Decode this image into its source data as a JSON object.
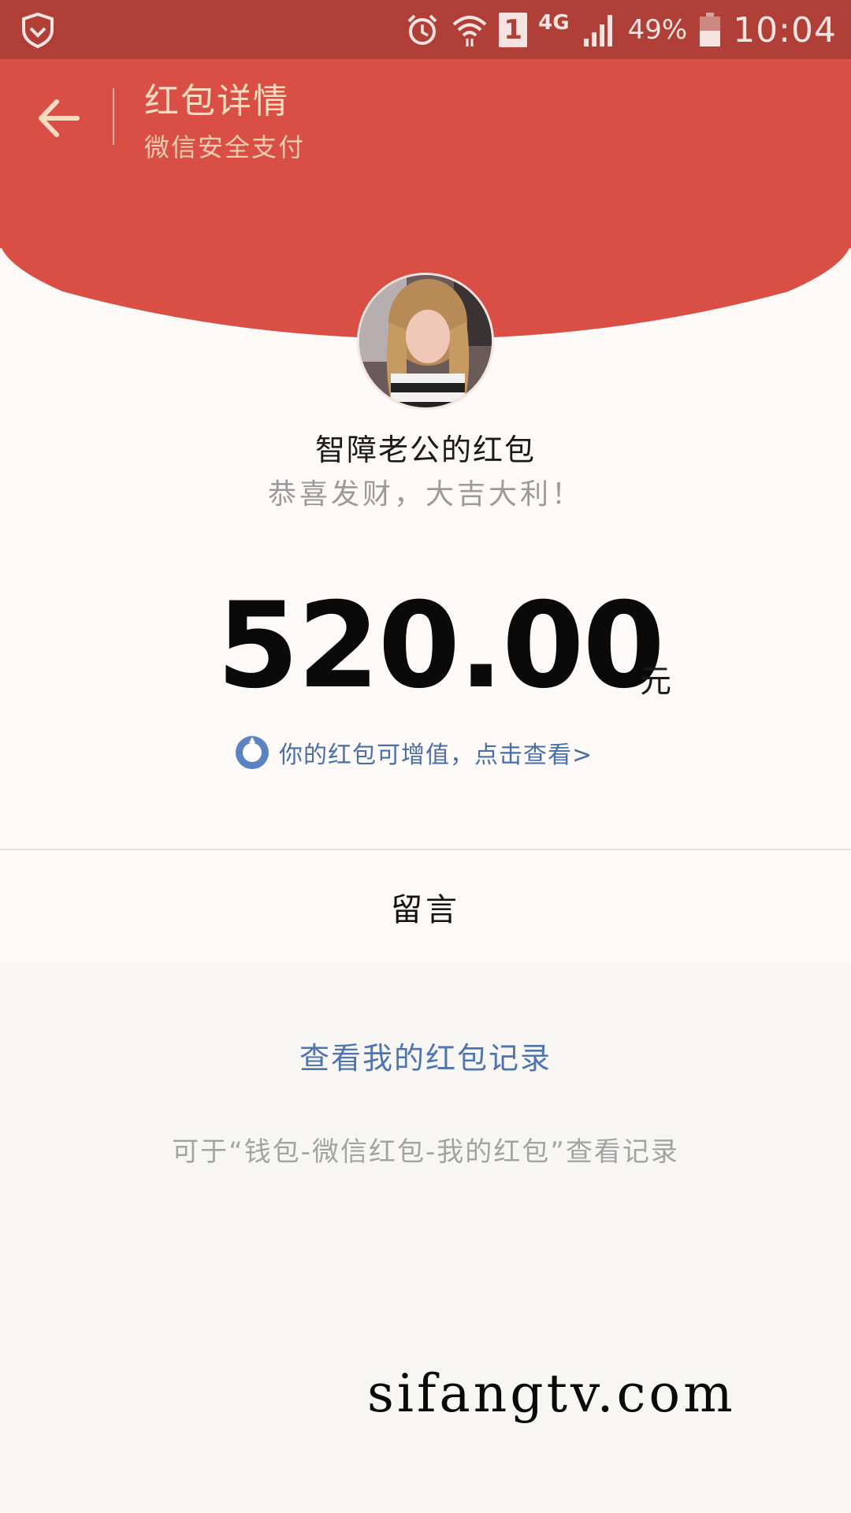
{
  "status_bar": {
    "network": "4G",
    "sim_slot": "1",
    "battery_percent": "49%",
    "time": "10:04",
    "icons": [
      "shield-icon",
      "alarm-icon",
      "wifi-icon",
      "sim-icon",
      "signal-icon",
      "battery-icon"
    ]
  },
  "header": {
    "title": "红包详情",
    "subtitle": "微信安全支付",
    "back_icon": "arrow-left-icon",
    "bg_color": "#d94f45"
  },
  "packet": {
    "sender": "智障老公的红包",
    "greeting": "恭喜发财，大吉大利！",
    "amount": "520.00",
    "unit": "元",
    "promo_text": "你的红包可增值，点击查看>"
  },
  "actions": {
    "message_label": "留言",
    "records_link": "查看我的红包记录",
    "records_hint": "可于“钱包-微信红包-我的红包”查看记录"
  },
  "watermark": {
    "site": "sifangtv.com"
  },
  "colors": {
    "accent_red": "#d94f45",
    "status_red": "#b03f37",
    "link_blue": "#4f74ae"
  }
}
